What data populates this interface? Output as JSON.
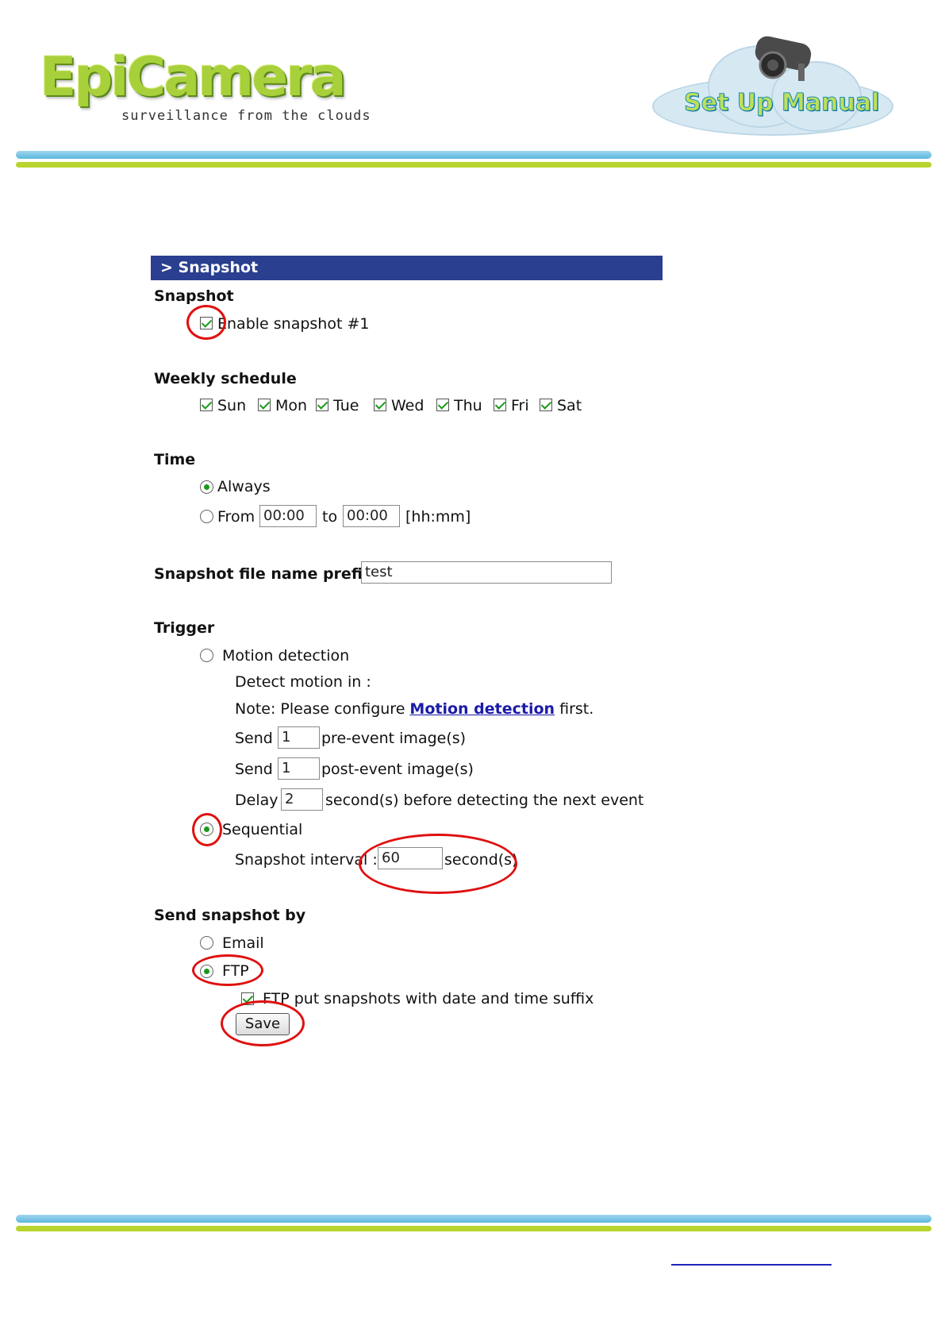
{
  "header": {
    "logo_text": "EpiCamera",
    "tagline": "surveillance from the clouds",
    "badge_text": "Set Up Manual"
  },
  "panel": {
    "title": "> Snapshot",
    "snapshot_section": {
      "heading": "Snapshot",
      "enable_label": "Enable snapshot #1",
      "enable_checked": true
    },
    "weekly_schedule": {
      "heading": "Weekly schedule",
      "days": [
        {
          "label": "Sun",
          "checked": true
        },
        {
          "label": "Mon",
          "checked": true
        },
        {
          "label": "Tue",
          "checked": true
        },
        {
          "label": "Wed",
          "checked": true
        },
        {
          "label": "Thu",
          "checked": true
        },
        {
          "label": "Fri",
          "checked": true
        },
        {
          "label": "Sat",
          "checked": true
        }
      ]
    },
    "time": {
      "heading": "Time",
      "always_label": "Always",
      "from_label": "From",
      "from_value": "00:00",
      "to_label": "to",
      "to_value": "00:00",
      "format_hint": "[hh:mm]",
      "selected": "Always"
    },
    "prefix": {
      "label": "Snapshot file name prefix",
      "value": "test"
    },
    "trigger": {
      "heading": "Trigger",
      "motion_label": "Motion detection",
      "detect_in_label": "Detect motion in :",
      "note_prefix": "Note: Please configure ",
      "note_link": "Motion detection",
      "note_suffix": " first.",
      "send_label": "Send",
      "pre_event_value": "1",
      "pre_event_label": "pre-event image(s)",
      "post_event_value": "1",
      "post_event_label": "post-event image(s)",
      "delay_label": "Delay",
      "delay_value": "2",
      "delay_suffix": "second(s) before detecting the next event",
      "sequential_label": "Sequential",
      "interval_label": "Snapshot interval :",
      "interval_value": "60",
      "interval_suffix": "second(s)",
      "selected": "Sequential"
    },
    "send_by": {
      "heading": "Send snapshot by",
      "email_label": "Email",
      "ftp_label": "FTP",
      "selected": "FTP",
      "ftp_suffix_label": "FTP put snapshots with date and time suffix",
      "ftp_suffix_checked": true
    },
    "save_label": "Save"
  },
  "colors": {
    "panel_header": "#2a3f8f",
    "highlight_ring": "#e01010",
    "check_green": "#1a9a1a",
    "link": "#1b1ba8"
  }
}
